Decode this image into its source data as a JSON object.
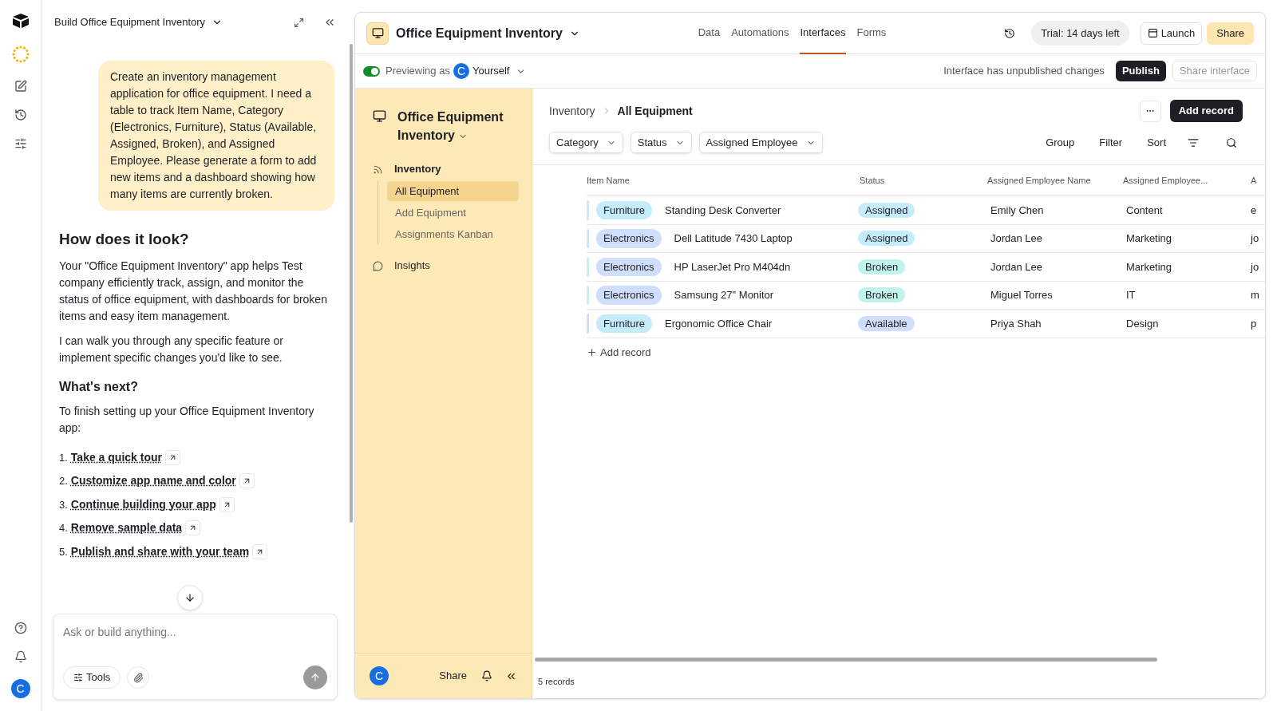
{
  "chat": {
    "title": "Build Office Equipment Inventory",
    "prompt": "Create an inventory management application for office equipment. I need a table to track Item Name, Category (Electronics, Furniture), Status (Available, Assigned, Broken), and Assigned Employee. Please generate a form to add new items and a dashboard showing how many items are currently broken.",
    "heading": "How does it look?",
    "paragraphs": [
      "Your \"Office Equipment Inventory\" app helps Test company efficiently track, assign, and monitor the status of office equipment, with dashboards for broken items and easy item management.",
      "I can walk you through any specific feature or implement specific changes you'd like to see."
    ],
    "subheading": "What's next?",
    "intro": "To finish setting up your Office Equipment Inventory app:",
    "steps": [
      {
        "number": "1.",
        "label": "Take a quick tour"
      },
      {
        "number": "2.",
        "label": "Customize app name and color"
      },
      {
        "number": "3.",
        "label": "Continue building your app"
      },
      {
        "number": "4.",
        "label": "Remove sample data"
      },
      {
        "number": "5.",
        "label": "Publish and share with your team"
      }
    ],
    "input": {
      "placeholder": "Ask or build anything..."
    },
    "tools_label": "Tools",
    "avatar": "C"
  },
  "app": {
    "title": "Office Equipment Inventory",
    "tabs": [
      {
        "label": "Data",
        "selected": false
      },
      {
        "label": "Automations",
        "selected": false
      },
      {
        "label": "Interfaces",
        "selected": true
      },
      {
        "label": "Forms",
        "selected": false
      }
    ],
    "trial": "Trial: 14 days left",
    "launch": "Launch",
    "share": "Share",
    "preview": {
      "on": true,
      "label": "Previewing as",
      "avatar": "C",
      "user": "Yourself"
    },
    "unpublished": "Interface has unpublished changes",
    "publish": "Publish",
    "share_interface": "Share interface"
  },
  "sidebar": {
    "title": "Office Equipment Inventory",
    "sections": [
      {
        "label": "Inventory",
        "kind": "feed",
        "children": [
          {
            "label": "All Equipment",
            "selected": true
          },
          {
            "label": "Add Equipment",
            "selected": false
          },
          {
            "label": "Assignments Kanban",
            "selected": false
          }
        ]
      },
      {
        "label": "Insights",
        "kind": "chat"
      }
    ],
    "avatar": "C",
    "share": "Share"
  },
  "page": {
    "breadcrumb": [
      "Inventory",
      "All Equipment"
    ],
    "add_record": "Add record",
    "filters": [
      "Category",
      "Status",
      "Assigned Employee"
    ],
    "actions": [
      "Group",
      "Filter",
      "Sort"
    ],
    "table": {
      "columns": [
        "Item Name",
        "Status",
        "Assigned Employee Name",
        "Assigned Employee...",
        "A"
      ],
      "rows": [
        {
          "color": "#c4ecfb",
          "category": {
            "label": "Furniture",
            "color": "#c4ecfb"
          },
          "item": "Standing Desk Converter",
          "status": {
            "label": "Assigned",
            "color": "#c4ecfb"
          },
          "employee": "Emily Chen",
          "department": "Content",
          "column_5": "e"
        },
        {
          "color": "#c4ecfb",
          "category": {
            "label": "Electronics",
            "color": "#cfdffb"
          },
          "item": "Dell Latitude 7430 Laptop",
          "status": {
            "label": "Assigned",
            "color": "#c4ecfb"
          },
          "employee": "Jordan Lee",
          "department": "Marketing",
          "column_5": "jo"
        },
        {
          "color": "#c2f3ea",
          "category": {
            "label": "Electronics",
            "color": "#cfdffb"
          },
          "item": "HP LaserJet Pro M404dn",
          "status": {
            "label": "Broken",
            "color": "#c2f3ea"
          },
          "employee": "Jordan Lee",
          "department": "Marketing",
          "column_5": "jo"
        },
        {
          "color": "#c2f3ea",
          "category": {
            "label": "Electronics",
            "color": "#cfdffb"
          },
          "item": "Samsung 27\" Monitor",
          "status": {
            "label": "Broken",
            "color": "#c2f3ea"
          },
          "employee": "Miguel Torres",
          "department": "IT",
          "column_5": "m"
        },
        {
          "color": "#cfdffb",
          "category": {
            "label": "Furniture",
            "color": "#c4ecfb"
          },
          "item": "Ergonomic Office Chair",
          "status": {
            "label": "Available",
            "color": "#cfdffb"
          },
          "employee": "Priya Shah",
          "department": "Design",
          "column_5": "p"
        }
      ],
      "add_row": "Add record"
    },
    "record_count": "5 records"
  }
}
